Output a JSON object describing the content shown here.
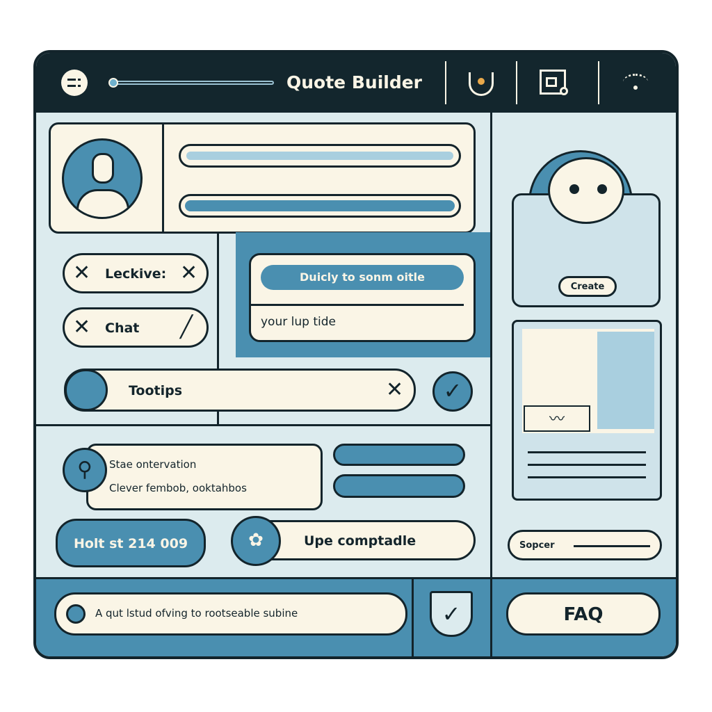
{
  "header": {
    "title": "Quote Builder",
    "icons": [
      "menu-icon",
      "slider",
      "tag-icon",
      "document-icon",
      "wifi-icon"
    ]
  },
  "chips": [
    {
      "label": "Leckive:"
    },
    {
      "label": "Chat"
    }
  ],
  "card": {
    "button_label": "Duicly to sonm oitle",
    "field_value": "your lup tide"
  },
  "tooltip_bar": {
    "label": "Tootips"
  },
  "observation": {
    "line1": "Stae ontervation",
    "line2": "Clever fembob, ooktahbos"
  },
  "primary_button": {
    "label": "Holt st 214 009"
  },
  "compatible_field": {
    "label": "Upe comptadle"
  },
  "footer": {
    "input_text": "A qut lstud ofving to rootseable subine",
    "faq_label": "FAQ"
  },
  "right_panel": {
    "create_label": "Create",
    "search_label": "Sopcer"
  },
  "colors": {
    "dark": "#13242b",
    "blue": "#4a8fb0",
    "cream": "#faf5e6",
    "panel": "#dcebee"
  }
}
